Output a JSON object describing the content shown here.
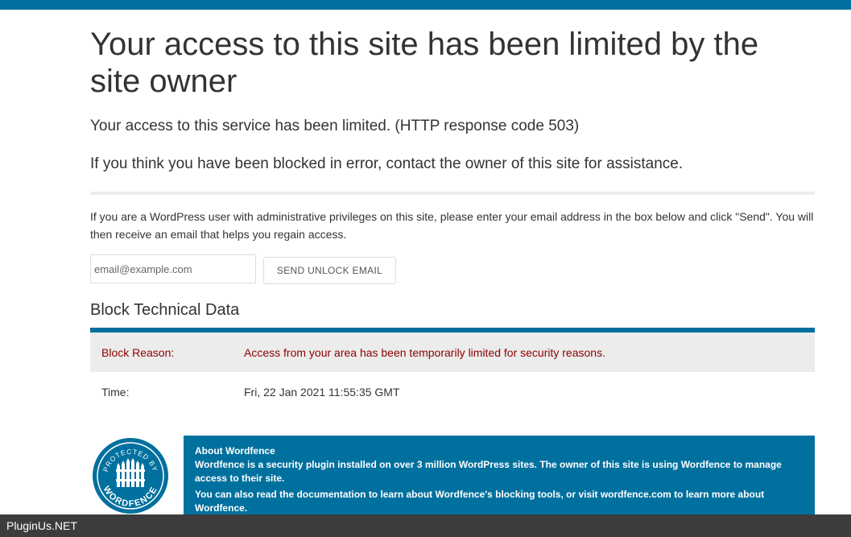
{
  "page": {
    "title": "Your access to this site has been limited by the site owner",
    "message_limited": "Your access to this service has been limited. (HTTP response code 503)",
    "message_contact": "If you think you have been blocked in error, contact the owner of this site for assistance."
  },
  "unlock": {
    "instructions": "If you are a WordPress user with administrative privileges on this site, please enter your email address in the box below and click \"Send\". You will then receive an email that helps you regain access.",
    "email_placeholder": "email@example.com",
    "send_label": "SEND UNLOCK EMAIL"
  },
  "block_data": {
    "heading": "Block Technical Data",
    "rows": [
      {
        "label": "Block Reason:",
        "value": "Access from your area has been temporarily limited for security reasons."
      },
      {
        "label": "Time:",
        "value": "Fri, 22 Jan 2021 11:55:35 GMT"
      }
    ]
  },
  "badge": {
    "top_text": "PROTECTED BY",
    "bottom_text": "WORDFENCE"
  },
  "about": {
    "title": "About Wordfence",
    "paragraph1": "Wordfence is a security plugin installed on over 3 million WordPress sites. The owner of this site is using Wordfence to manage access to their site.",
    "paragraph2": "You can also read the documentation to learn about Wordfence's blocking tools, or visit wordfence.com to learn more about Wordfence."
  },
  "watermark": {
    "text": "PluginUs.NET"
  },
  "colors": {
    "accent": "#00709e",
    "reason_text": "#8b0000",
    "shade": "#ececec",
    "watermark_bar": "#3c3c3c"
  }
}
